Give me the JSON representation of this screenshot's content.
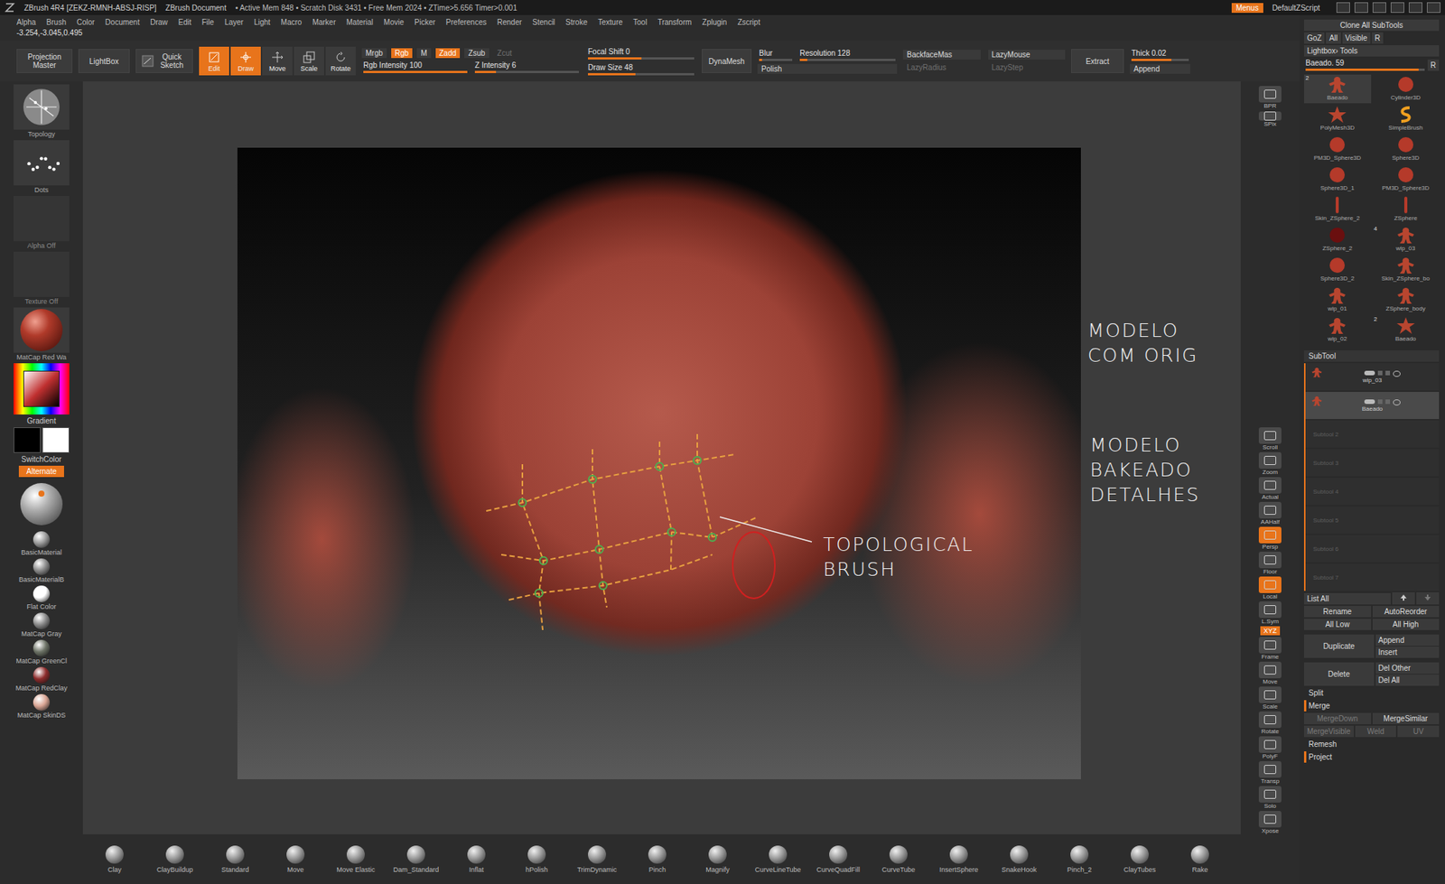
{
  "window": {
    "title": "ZBrush 4R4 [ZEKZ-RMNH-ABSJ-RISP]",
    "document": "ZBrush Document",
    "stats": "• Active Mem 848 • Scratch Disk 3431 • Free Mem 2024 • ZTime>5.656 Timer>0.001",
    "menus_button": {
      "label": "Menus",
      "selected": true
    },
    "script": "DefaultZScript"
  },
  "menubar": [
    "Alpha",
    "Brush",
    "Color",
    "Document",
    "Draw",
    "Edit",
    "File",
    "Layer",
    "Light",
    "Macro",
    "Marker",
    "Material",
    "Movie",
    "Picker",
    "Preferences",
    "Render",
    "Stencil",
    "Stroke",
    "Texture",
    "Tool",
    "Transform",
    "Zplugin",
    "Zscript"
  ],
  "coordinates": "-3.254,-3.045,0.495",
  "top_shelf": {
    "projection_master": "Projection Master",
    "lightbox": "LightBox",
    "quick_sketch": "Quick Sketch",
    "modes": [
      {
        "label": "Edit",
        "selected": true,
        "kind": "edit"
      },
      {
        "label": "Draw",
        "selected": true,
        "kind": "draw"
      },
      {
        "label": "Move",
        "selected": false,
        "kind": "move"
      },
      {
        "label": "Scale",
        "selected": false,
        "kind": "scale"
      },
      {
        "label": "Rotate",
        "selected": false,
        "kind": "rotate"
      }
    ],
    "channels": [
      {
        "label": "Mrgb",
        "selected": false,
        "disabled": false
      },
      {
        "label": "Rgb",
        "selected": true,
        "disabled": false
      },
      {
        "label": "M",
        "selected": false,
        "disabled": false
      }
    ],
    "depth": [
      {
        "label": "Zadd",
        "selected": true,
        "disabled": false
      },
      {
        "label": "Zsub",
        "selected": false,
        "disabled": false
      },
      {
        "label": "Zcut",
        "selected": false,
        "disabled": true
      }
    ],
    "intensity": [
      {
        "label": "Rgb Intensity 100",
        "level": 1
      },
      {
        "label": "Z Intensity 6",
        "level": 0.2
      }
    ],
    "focal": [
      {
        "label": "Focal Shift 0",
        "level": 0.5
      },
      {
        "label": "Draw Size 48",
        "level": 0.45
      }
    ],
    "dynamesh": "DynaMesh",
    "blur": {
      "label": "Blur",
      "level": 0.1
    },
    "resolution": {
      "label": "Resolution 128",
      "level": 0.08
    },
    "polish": "Polish",
    "lazy": [
      {
        "label": "BackfaceMas",
        "disabled": false
      },
      {
        "label": "LazyMouse",
        "disabled": false
      },
      {
        "label": "LazyRadius",
        "disabled": true
      },
      {
        "label": "LazyStep",
        "disabled": true
      }
    ],
    "extract": "Extract",
    "thick": {
      "label": "Thick 0.02",
      "level": 0.7
    },
    "append": "Append"
  },
  "left_shelf": {
    "brush": "Topology",
    "stroke": "Dots",
    "alpha": "Alpha Off",
    "texture": "Texture Off",
    "material": "MatCap Red Wa",
    "gradient": "Gradient",
    "main_color": "#000000",
    "secondary_color": "#ffffff",
    "switch_color": "SwitchColor",
    "alternate": {
      "label": "Alternate",
      "selected": true
    },
    "materials": [
      {
        "name": "BasicMaterial",
        "color": "#9a9a9a"
      },
      {
        "name": "BasicMaterialB",
        "color": "#8c8c8c"
      },
      {
        "name": "Flat Color",
        "color": "#ffffff"
      },
      {
        "name": "MatCap Gray",
        "color": "#8a8a8a"
      },
      {
        "name": "MatCap GreenCl",
        "color": "#6d7366"
      },
      {
        "name": "MatCap RedClay",
        "color": "#8e2c2c"
      },
      {
        "name": "MatCap SkinDS",
        "color": "#d9a594"
      }
    ]
  },
  "right_shelf": [
    {
      "label": "BPR",
      "selected": false,
      "kind": "button"
    },
    {
      "label": "SPix",
      "selected": false,
      "kind": "slider"
    },
    {
      "label": "Scroll",
      "selected": false,
      "kind": "button"
    },
    {
      "label": "Zoom",
      "selected": false,
      "kind": "button"
    },
    {
      "label": "Actual",
      "selected": false,
      "kind": "button"
    },
    {
      "label": "AAHalf",
      "selected": false,
      "kind": "button"
    },
    {
      "label": "Persp",
      "selected": true,
      "kind": "button"
    },
    {
      "label": "Floor",
      "selected": false,
      "kind": "button"
    },
    {
      "label": "Local",
      "selected": true,
      "kind": "button"
    },
    {
      "label": "L.Sym",
      "selected": false,
      "kind": "button"
    },
    {
      "label": "XYZ",
      "selected": true,
      "kind": "small"
    },
    {
      "label": "Frame",
      "selected": false,
      "kind": "button"
    },
    {
      "label": "Move",
      "selected": false,
      "kind": "button"
    },
    {
      "label": "Scale",
      "selected": false,
      "kind": "button"
    },
    {
      "label": "Rotate",
      "selected": false,
      "kind": "button"
    },
    {
      "label": "PolyF",
      "selected": false,
      "kind": "button"
    },
    {
      "label": "Transp",
      "selected": false,
      "kind": "button"
    },
    {
      "label": "Solo",
      "selected": false,
      "kind": "button"
    },
    {
      "label": "Xpose",
      "selected": false,
      "kind": "button"
    }
  ],
  "annotations": [
    {
      "lines": [
        "MODELO",
        "COM ORIG"
      ]
    },
    {
      "lines": [
        "MODELO",
        "BAKEADO",
        "DETALHES"
      ]
    },
    {
      "lines": [
        "TOPOLOGICAL",
        "BRUSH"
      ]
    }
  ],
  "palette": {
    "clone": "Clone All SubTools",
    "goz": [
      "GoZ",
      "All",
      "Visible",
      "R"
    ],
    "lightbox_tools": "Lightbox› Tools",
    "tool_slider": {
      "label": "Baeado. 59",
      "level": 0.95
    },
    "tool_slider_r": "R",
    "tools": [
      {
        "name": "Baeado",
        "badge": "2",
        "kind": "figure",
        "selected": true
      },
      {
        "name": "Cylinder3D",
        "badge": "",
        "kind": "sphere",
        "selected": false
      },
      {
        "name": "PolyMesh3D",
        "badge": "",
        "kind": "star",
        "selected": false
      },
      {
        "name": "SimpleBrush",
        "badge": "",
        "kind": "brush",
        "selected": false
      },
      {
        "name": "PM3D_Sphere3D",
        "badge": "",
        "kind": "sphere",
        "selected": false
      },
      {
        "name": "Sphere3D",
        "badge": "",
        "kind": "sphere",
        "selected": false
      },
      {
        "name": "Sphere3D_1",
        "badge": "",
        "kind": "sphere",
        "selected": false
      },
      {
        "name": "PM3D_Sphere3D",
        "badge": "",
        "kind": "sphere",
        "selected": false
      },
      {
        "name": "Skin_ZSphere_2",
        "badge": "",
        "kind": "rod",
        "selected": false
      },
      {
        "name": "ZSphere",
        "badge": "",
        "kind": "rod",
        "selected": false
      },
      {
        "name": "ZSphere_2",
        "badge": "",
        "kind": "dark",
        "selected": false
      },
      {
        "name": "wip_03",
        "badge": "4",
        "kind": "figure",
        "selected": false
      },
      {
        "name": "Sphere3D_2",
        "badge": "",
        "kind": "sphere",
        "selected": false
      },
      {
        "name": "Skin_ZSphere_bo",
        "badge": "",
        "kind": "figure",
        "selected": false
      },
      {
        "name": "wip_01",
        "badge": "",
        "kind": "figure",
        "selected": false
      },
      {
        "name": "ZSphere_body",
        "badge": "",
        "kind": "figure",
        "selected": false
      },
      {
        "name": "wip_02",
        "badge": "",
        "kind": "figure",
        "selected": false
      },
      {
        "name": "Baeado",
        "badge": "2",
        "kind": "star",
        "selected": false
      }
    ],
    "subtool_title": "SubTool",
    "subtools": [
      {
        "name": "wip_03",
        "selected": false,
        "kind": "mesh"
      },
      {
        "name": "Baeado",
        "selected": true,
        "kind": "mesh"
      },
      {
        "name": "Subtool 2",
        "selected": false,
        "kind": "empty"
      },
      {
        "name": "Subtool 3",
        "selected": false,
        "kind": "empty"
      },
      {
        "name": "Subtool 4",
        "selected": false,
        "kind": "empty"
      },
      {
        "name": "Subtool 5",
        "selected": false,
        "kind": "empty"
      },
      {
        "name": "Subtool 6",
        "selected": false,
        "kind": "empty"
      },
      {
        "name": "Subtool 7",
        "selected": false,
        "kind": "empty"
      }
    ],
    "list_all": "List All",
    "button_rows": [
      [
        {
          "label": "Rename",
          "disabled": false
        },
        {
          "label": "AutoReorder",
          "disabled": false
        }
      ],
      [
        {
          "label": "All Low",
          "disabled": false
        },
        {
          "label": "All High",
          "disabled": false
        }
      ]
    ],
    "duplicate": {
      "main": "Duplicate",
      "side": [
        "Append",
        "Insert"
      ]
    },
    "delete": {
      "main": "Delete",
      "side": [
        "Del Other",
        "Del All"
      ]
    },
    "split": {
      "label": "Split",
      "expanded": false
    },
    "merge": {
      "label": "Merge",
      "expanded": true,
      "rows": [
        [
          {
            "label": "MergeDown",
            "disabled": true
          },
          {
            "label": "MergeSimilar",
            "disabled": false
          }
        ],
        [
          {
            "label": "MergeVisible",
            "disabled": true
          },
          {
            "label": "Weld",
            "disabled": true
          },
          {
            "label": "UV",
            "disabled": true
          }
        ]
      ]
    },
    "after": [
      {
        "label": "Remesh",
        "expanded": false
      },
      {
        "label": "Project",
        "expanded": true
      }
    ]
  },
  "bottom_shelf": [
    "Clay",
    "ClayBuildup",
    "Standard",
    "Move",
    "Move Elastic",
    "Dam_Standard",
    "Inflat",
    "hPolish",
    "TrimDynamic",
    "Pinch",
    "Magnify",
    "CurveLineTube",
    "CurveQuadFill",
    "CurveTube",
    "InsertSphere",
    "SnakeHook",
    "Pinch_2",
    "ClayTubes",
    "Rake"
  ]
}
